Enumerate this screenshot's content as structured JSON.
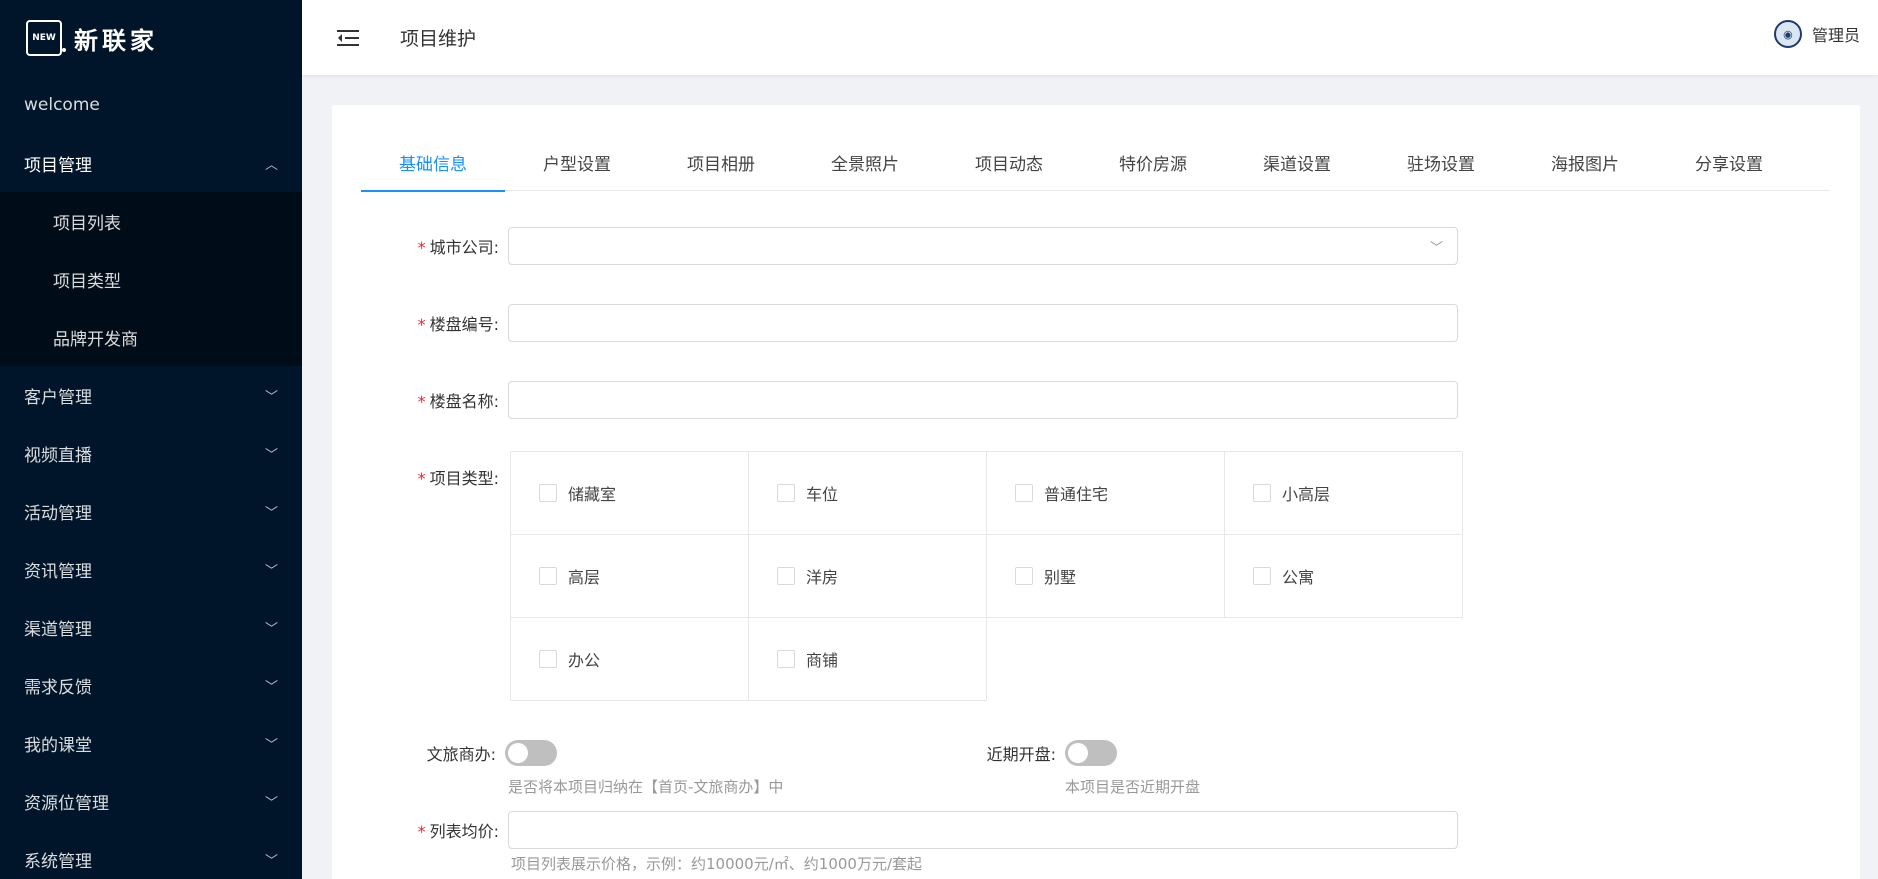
{
  "brand": {
    "logo_mark": "NEW",
    "name": "新联家"
  },
  "sidebar": {
    "items": [
      {
        "label": "welcome"
      },
      {
        "label": "项目管理"
      },
      {
        "label": "项目列表"
      },
      {
        "label": "项目类型"
      },
      {
        "label": "品牌开发商"
      },
      {
        "label": "客户管理"
      },
      {
        "label": "视频直播"
      },
      {
        "label": "活动管理"
      },
      {
        "label": "资讯管理"
      },
      {
        "label": "渠道管理"
      },
      {
        "label": "需求反馈"
      },
      {
        "label": "我的课堂"
      },
      {
        "label": "资源位管理"
      },
      {
        "label": "系统管理"
      }
    ]
  },
  "header": {
    "title": "项目维护",
    "user": "管理员"
  },
  "tabs": [
    "基础信息",
    "户型设置",
    "项目相册",
    "全景照片",
    "项目动态",
    "特价房源",
    "渠道设置",
    "驻场设置",
    "海报图片",
    "分享设置"
  ],
  "form": {
    "required_mark": "*",
    "city_label": "城市公司:",
    "code_label": "楼盘编号:",
    "name_label": "楼盘名称:",
    "type_label": "项目类型:",
    "types": [
      "储藏室",
      "车位",
      "普通住宅",
      "小高层",
      "高层",
      "洋房",
      "别墅",
      "公寓",
      "办公",
      "商铺"
    ],
    "wenlv_label": "文旅商办:",
    "wenlv_hint": "是否将本项目归纳在【首页-文旅商办】中",
    "recent_label": "近期开盘:",
    "recent_hint": "本项目是否近期开盘",
    "price_label": "列表均价:",
    "price_hint": "项目列表展示价格，示例：约10000元/㎡、约1000万元/套起"
  },
  "colors": {
    "sidebar": "#001529",
    "accent": "#1890ff",
    "required": "#f5222d"
  }
}
